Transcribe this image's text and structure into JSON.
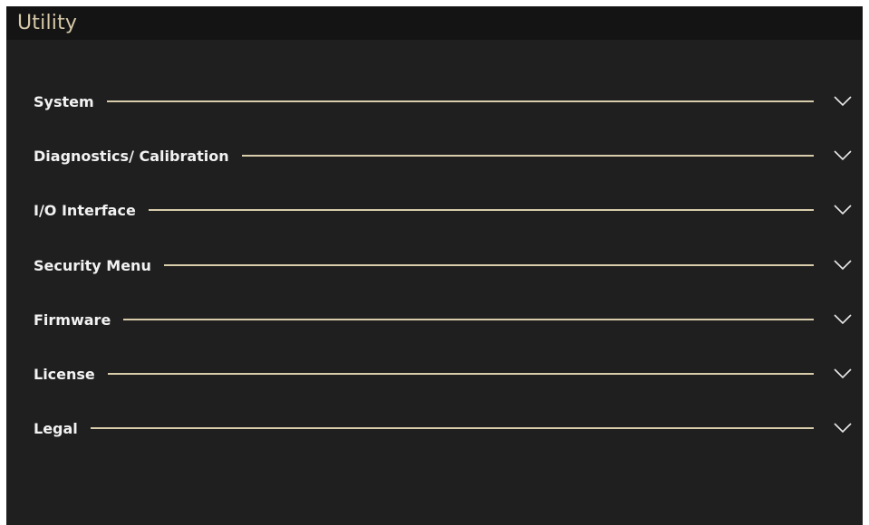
{
  "header": {
    "title": "Utility"
  },
  "menu": {
    "items": [
      {
        "label": "System",
        "icon": "chevron-down-icon"
      },
      {
        "label": "Diagnostics/ Calibration",
        "icon": "chevron-down-icon"
      },
      {
        "label": "I/O Interface",
        "icon": "chevron-down-icon"
      },
      {
        "label": "Security Menu",
        "icon": "chevron-down-icon"
      },
      {
        "label": "Firmware",
        "icon": "chevron-down-icon"
      },
      {
        "label": "License",
        "icon": "chevron-down-icon"
      },
      {
        "label": "Legal",
        "icon": "chevron-down-icon"
      }
    ]
  },
  "colors": {
    "background": "#1f1f1f",
    "title_bar": "#141414",
    "title_text": "#d6c8a8",
    "label_text": "#f2f2f2",
    "divider": "#d8ccaa",
    "chevron": "#e8e8e8"
  }
}
